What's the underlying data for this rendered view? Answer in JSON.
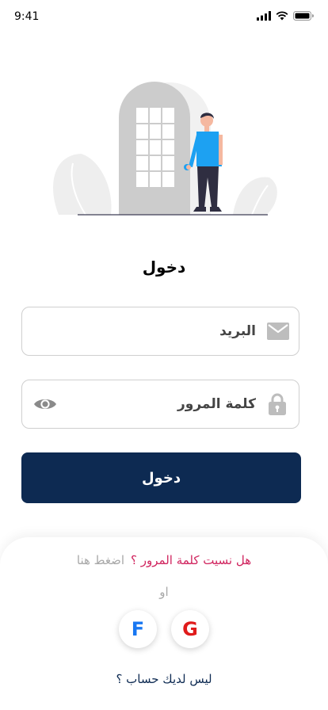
{
  "status_bar": {
    "time": "9:41",
    "icons": [
      "signal-icon",
      "wifi-icon",
      "battery-icon"
    ]
  },
  "illustration": {
    "name": "person-at-door-illustration"
  },
  "login": {
    "title": "دخول",
    "email_placeholder": "البريد",
    "email_icon": "envelope-icon",
    "password_placeholder": "كلمة المرور",
    "password_icon": "lock-icon",
    "password_toggle_icon": "eye-icon",
    "submit_label": "دخول"
  },
  "footer": {
    "forgot_text": "هل نسيت كلمة المرور ؟",
    "forgot_link": "اضغط هنا",
    "or_text": "او",
    "social": {
      "facebook": "F",
      "google": "G"
    },
    "no_account": "ليس لديك حساب ؟"
  },
  "colors": {
    "primary": "#0d2a52",
    "accent": "#d0245e",
    "muted": "#a8a8a8",
    "figure_shirt": "#1da1f2",
    "facebook": "#1877f2",
    "google": "#e01b1b"
  }
}
